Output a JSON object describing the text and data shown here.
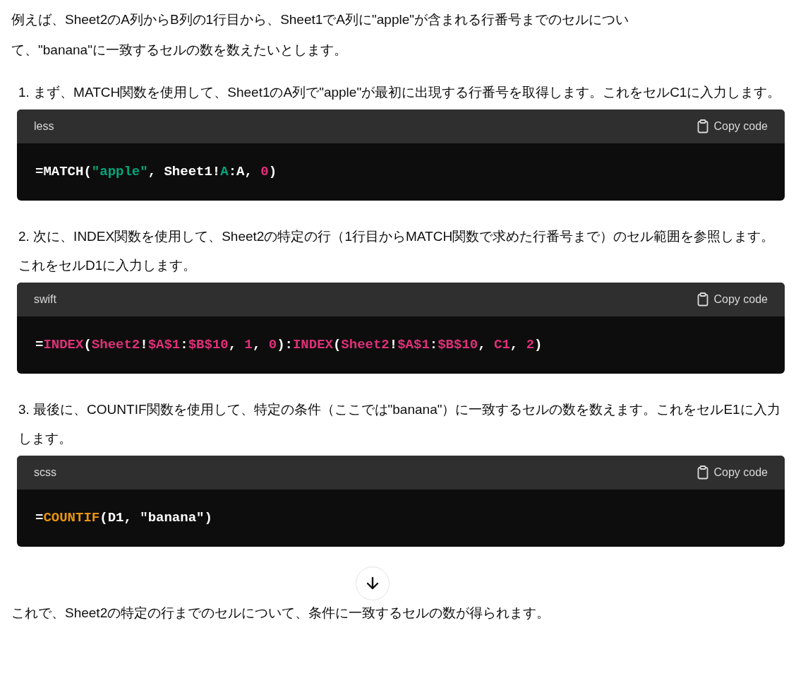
{
  "intro": "例えば、Sheet2のA列からB列の1行目から、Sheet1でA列に\"apple\"が含まれる行番号までのセルについて、\"banana\"に一致するセルの数を数えたいとします。",
  "steps": [
    {
      "number": "1.",
      "text": "まず、MATCH関数を使用して、Sheet1のA列で\"apple\"が最初に出現する行番号を取得します。これをセルC1に入力します。",
      "code": {
        "language": "less",
        "copy_label": "Copy code",
        "tokens": [
          {
            "kind": "plain",
            "text": "=MATCH("
          },
          {
            "kind": "string",
            "text": "\"apple\""
          },
          {
            "kind": "plain",
            "text": ", Sheet1!"
          },
          {
            "kind": "string",
            "text": "A"
          },
          {
            "kind": "plain",
            "text": ":A, "
          },
          {
            "kind": "number",
            "text": "0"
          },
          {
            "kind": "plain",
            "text": ")"
          }
        ]
      }
    },
    {
      "number": "2.",
      "text": "次に、INDEX関数を使用して、Sheet2の特定の行（1行目からMATCH関数で求めた行番号まで）のセル範囲を参照します。これをセルD1に入力します。",
      "code": {
        "language": "swift",
        "copy_label": "Copy code",
        "tokens": [
          {
            "kind": "plain",
            "text": "="
          },
          {
            "kind": "number",
            "text": "INDEX"
          },
          {
            "kind": "plain",
            "text": "("
          },
          {
            "kind": "number",
            "text": "Sheet2"
          },
          {
            "kind": "plain",
            "text": "!"
          },
          {
            "kind": "number",
            "text": "$A$1"
          },
          {
            "kind": "plain",
            "text": ":"
          },
          {
            "kind": "number",
            "text": "$B$10"
          },
          {
            "kind": "plain",
            "text": ", "
          },
          {
            "kind": "number",
            "text": "1"
          },
          {
            "kind": "plain",
            "text": ", "
          },
          {
            "kind": "number",
            "text": "0"
          },
          {
            "kind": "plain",
            "text": "):"
          },
          {
            "kind": "number",
            "text": "INDEX"
          },
          {
            "kind": "plain",
            "text": "("
          },
          {
            "kind": "number",
            "text": "Sheet2"
          },
          {
            "kind": "plain",
            "text": "!"
          },
          {
            "kind": "number",
            "text": "$A$1"
          },
          {
            "kind": "plain",
            "text": ":"
          },
          {
            "kind": "number",
            "text": "$B$10"
          },
          {
            "kind": "plain",
            "text": ", "
          },
          {
            "kind": "number",
            "text": "C1"
          },
          {
            "kind": "plain",
            "text": ", "
          },
          {
            "kind": "number",
            "text": "2"
          },
          {
            "kind": "plain",
            "text": ")"
          }
        ]
      }
    },
    {
      "number": "3.",
      "text": "最後に、COUNTIF関数を使用して、特定の条件（ここでは\"banana\"）に一致するセルの数を数えます。これをセルE1に入力します。",
      "code": {
        "language": "scss",
        "copy_label": "Copy code",
        "tokens": [
          {
            "kind": "plain",
            "text": "="
          },
          {
            "kind": "builtin",
            "text": "COUNTIF"
          },
          {
            "kind": "plain",
            "text": "(D1, \"banana\")"
          }
        ]
      }
    }
  ],
  "outro": "これで、Sheet2の特定の行までのセルについて、条件に一致するセルの数が得られます。"
}
